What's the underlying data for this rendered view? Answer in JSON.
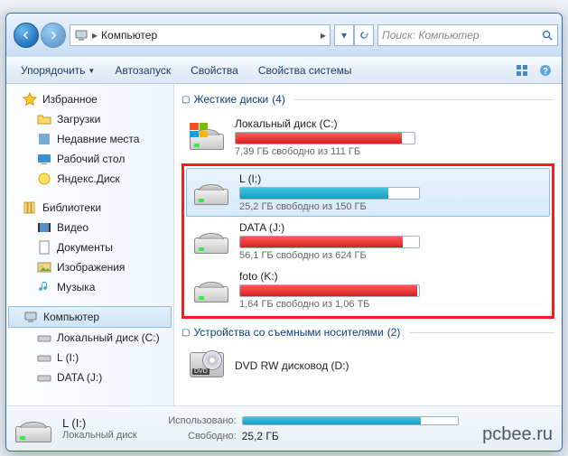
{
  "background_hint": "Видео...",
  "breadcrumb": {
    "path": "Компьютер",
    "arrow": "▸"
  },
  "search_placeholder": "Поиск: Компьютер",
  "toolbar": {
    "organize": "Упорядочить",
    "autorun": "Автозапуск",
    "properties": "Свойства",
    "sysprops": "Свойства системы"
  },
  "sidebar": {
    "favorites": {
      "label": "Избранное",
      "items": [
        {
          "label": "Загрузки"
        },
        {
          "label": "Недавние места"
        },
        {
          "label": "Рабочий стол"
        },
        {
          "label": "Яндекс.Диск"
        }
      ]
    },
    "libraries": {
      "label": "Библиотеки",
      "items": [
        {
          "label": "Видео"
        },
        {
          "label": "Документы"
        },
        {
          "label": "Изображения"
        },
        {
          "label": "Музыка"
        }
      ]
    },
    "computer": {
      "label": "Компьютер",
      "items": [
        {
          "label": "Локальный диск (C:)"
        },
        {
          "label": "L (I:)"
        },
        {
          "label": "DATA (J:)"
        }
      ]
    }
  },
  "sections": {
    "hdd": {
      "title": "Жесткие диски",
      "count": "(4)"
    },
    "removable": {
      "title": "Устройства со съемными носителями",
      "count": "(2)"
    }
  },
  "drives": [
    {
      "name": "Локальный диск (C:)",
      "status": "7,39 ГБ свободно из 111 ГБ",
      "pct": 93,
      "low": true,
      "os": true
    },
    {
      "name": "L (I:)",
      "status": "25,2 ГБ свободно из 150 ГБ",
      "pct": 83,
      "low": false,
      "selected": true
    },
    {
      "name": "DATA (J:)",
      "status": "56,1 ГБ свободно из 624 ГБ",
      "pct": 91,
      "low": true
    },
    {
      "name": "foto (K:)",
      "status": "1,64 ГБ свободно из 1,06 ТБ",
      "pct": 99,
      "low": true
    }
  ],
  "removable": [
    {
      "name": "DVD RW дисковод (D:)"
    }
  ],
  "details": {
    "title": "L (I:)",
    "subtitle": "Локальный диск",
    "used_label": "Использовано:",
    "free_label": "Свободно:",
    "free_value": "25,2 ГБ",
    "bar_pct": 83
  },
  "watermark": "pcbee.ru"
}
